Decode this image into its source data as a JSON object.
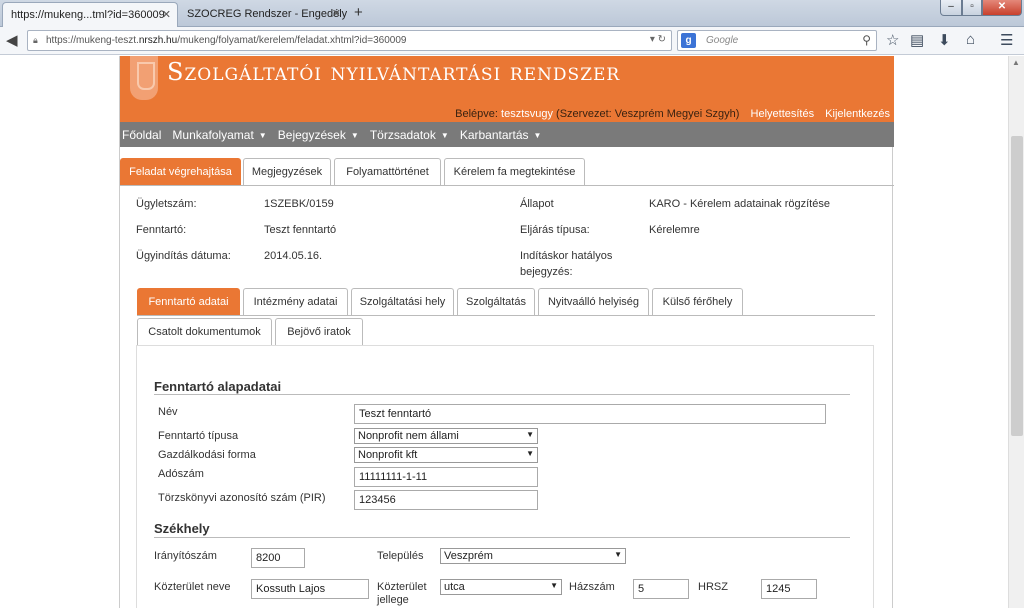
{
  "browser": {
    "tabs": [
      {
        "title": "https://mukeng...tml?id=360009"
      },
      {
        "title": "SZOCREG Rendszer - Engedély ..."
      }
    ],
    "url_prefix": "https://mukeng-teszt.",
    "url_domain": "nrszh.hu",
    "url_suffix": "/mukeng/folyamat/kerelem/feladat.xhtml?id=360009",
    "search_placeholder": "Google"
  },
  "header": {
    "title": "Szolgáltatói nyilvántartási rendszer",
    "login_label": "Belépve:",
    "username": "tesztsvugy",
    "org": "(Szervezet: Veszprém Megyei Szgyh)",
    "link_substitutions": "Helyettesítés",
    "link_logout": "Kijelentkezés",
    "accent_color": "#ea7734"
  },
  "menu": [
    {
      "label": "Főoldal",
      "caret": false
    },
    {
      "label": "Munkafolyamat",
      "caret": true
    },
    {
      "label": "Bejegyzések",
      "caret": true
    },
    {
      "label": "Törzsadatok",
      "caret": true
    },
    {
      "label": "Karbantartás",
      "caret": true
    }
  ],
  "main_tabs": [
    {
      "label": "Feladat végrehajtása",
      "active": true
    },
    {
      "label": "Megjegyzések",
      "active": false
    },
    {
      "label": "Folyamattörténet",
      "active": false
    },
    {
      "label": "Kérelem fa megtekintése",
      "active": false
    }
  ],
  "case_info": {
    "case_number_label": "Ügyletszám:",
    "case_number": "1SZEBK/0159",
    "state_label": "Állapot",
    "state": "KARO - Kérelem adatainak rögzítése",
    "maintainer_label": "Fenntartó:",
    "maintainer": "Teszt fenntartó",
    "procedure_label": "Eljárás típusa:",
    "procedure": "Kérelemre",
    "start_date_label": "Ügyindítás dátuma:",
    "start_date": "2014.05.16.",
    "effective_entry_label_1": "Indításkor hatályos",
    "effective_entry_label_2": "bejegyzés:"
  },
  "sub_tabs": [
    {
      "label": "Fenntartó adatai",
      "active": true
    },
    {
      "label": "Intézmény adatai",
      "active": false
    },
    {
      "label": "Szolgáltatási hely",
      "active": false
    },
    {
      "label": "Szolgáltatás",
      "active": false
    },
    {
      "label": "Nyitvaálló helyiség",
      "active": false
    },
    {
      "label": "Külső férőhely",
      "active": false
    },
    {
      "label": "Csatolt dokumentumok",
      "active": false
    },
    {
      "label": "Bejövő iratok",
      "active": false
    }
  ],
  "form": {
    "section_basic": "Fenntartó alapadatai",
    "name_label": "Név",
    "name_value": "Teszt fenntartó",
    "type_label": "Fenntartó típusa",
    "type_value": "Nonprofit nem állami",
    "business_label": "Gazdálkodási forma",
    "business_value": "Nonprofit kft",
    "tax_label": "Adószám",
    "tax_value": "11111111-1-11",
    "pir_label": "Törzskönyvi azonosító szám (PIR)",
    "pir_value": "123456",
    "section_seat": "Székhely",
    "zip_label": "Irányítószám",
    "zip_value": "8200",
    "city_label": "Település",
    "city_value": "Veszprém",
    "street_label": "Közterület neve",
    "street_value": "Kossuth Lajos",
    "street_type_label_1": "Közterület",
    "street_type_label_2": "jellege",
    "street_type_value": "utca",
    "house_label": "Házszám",
    "house_value": "5",
    "hrsz_label": "HRSZ",
    "hrsz_value": "1245"
  }
}
